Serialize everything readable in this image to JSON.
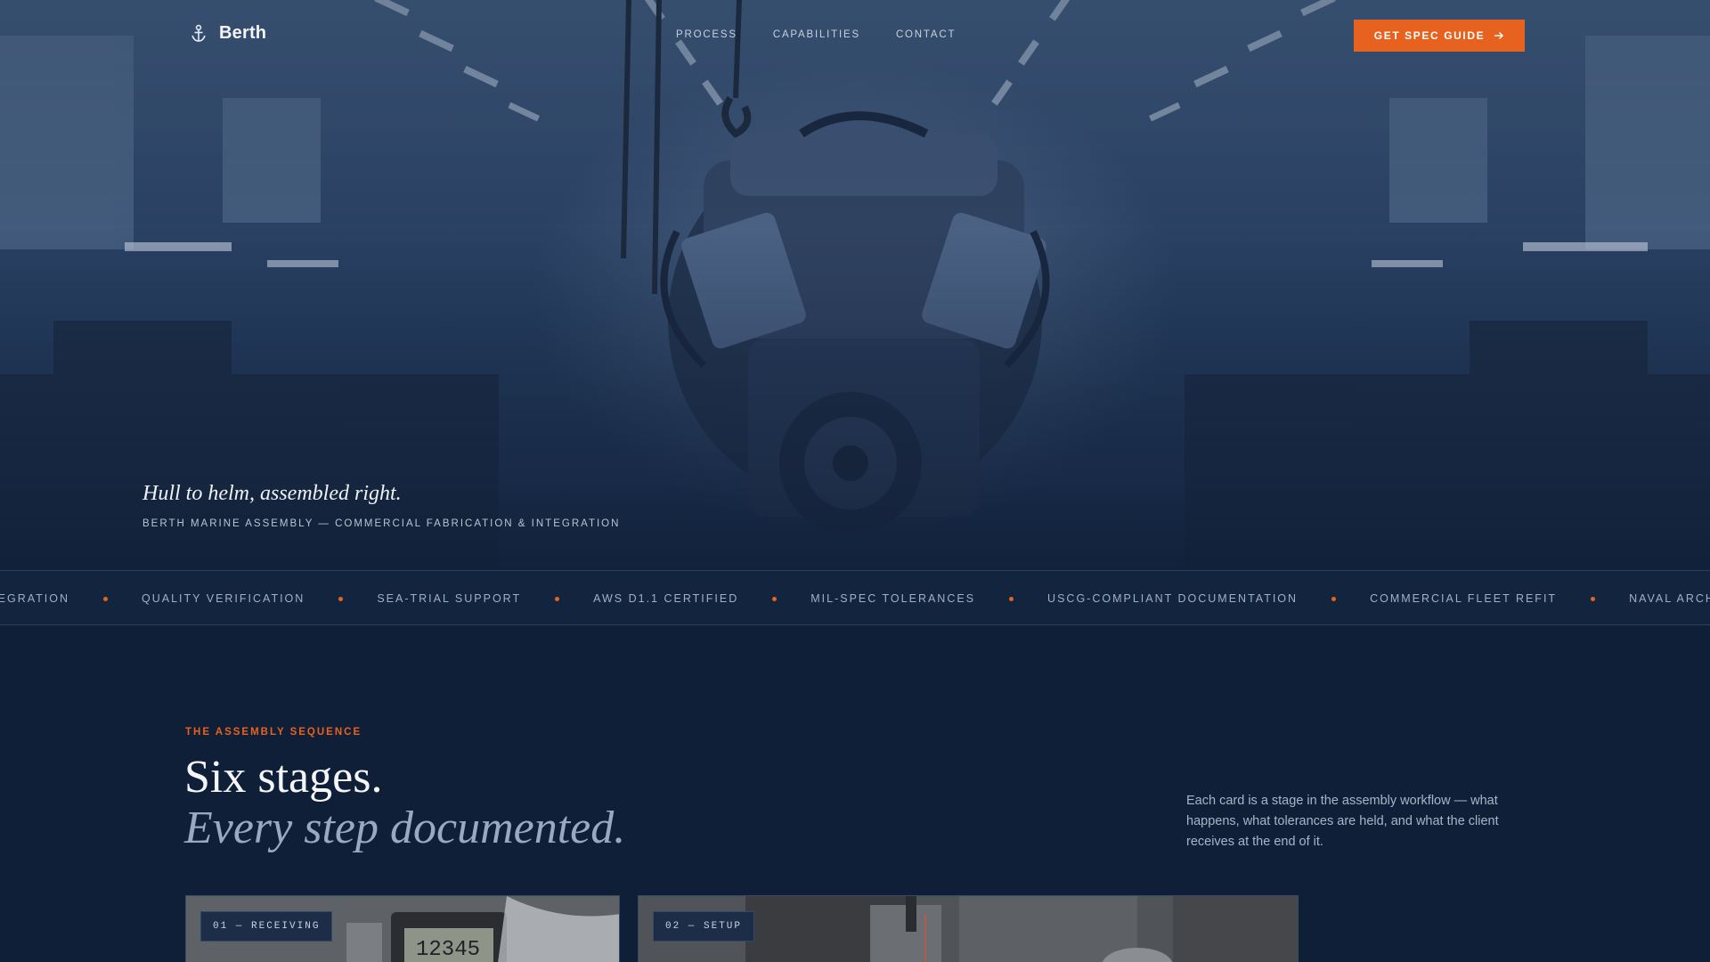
{
  "nav": {
    "brand": "Berth",
    "links": [
      "PROCESS",
      "CAPABILITIES",
      "CONTACT"
    ],
    "cta_label": "GET SPEC GUIDE"
  },
  "hero": {
    "tagline": "Hull to helm, assembled right.",
    "subtag": "BERTH MARINE ASSEMBLY — COMMERCIAL FABRICATION & INTEGRATION"
  },
  "ticker": {
    "items": [
      "TEGRATION",
      "QUALITY VERIFICATION",
      "SEA-TRIAL SUPPORT",
      "AWS D1.1 CERTIFIED",
      "MIL-SPEC TOLERANCES",
      "USCG-COMPLIANT DOCUMENTATION",
      "COMMERCIAL FLEET REFIT",
      "NAVAL ARCHITECTURE LIA"
    ]
  },
  "section": {
    "eyebrow": "THE ASSEMBLY SEQUENCE",
    "heading_line1": "Six stages.",
    "heading_line2": "Every step documented.",
    "description": "Each card is a stage in the assembly workflow — what happens, what tolerances are held, and what the client receives at the end of it."
  },
  "cards": [
    {
      "tag": "01 — RECEIVING"
    },
    {
      "tag": "02 — SETUP"
    }
  ],
  "colors": {
    "accent": "#e8621f",
    "background": "#0f1f38"
  },
  "icons": {
    "brand": "anchor-icon",
    "cta": "arrow-right-icon"
  }
}
